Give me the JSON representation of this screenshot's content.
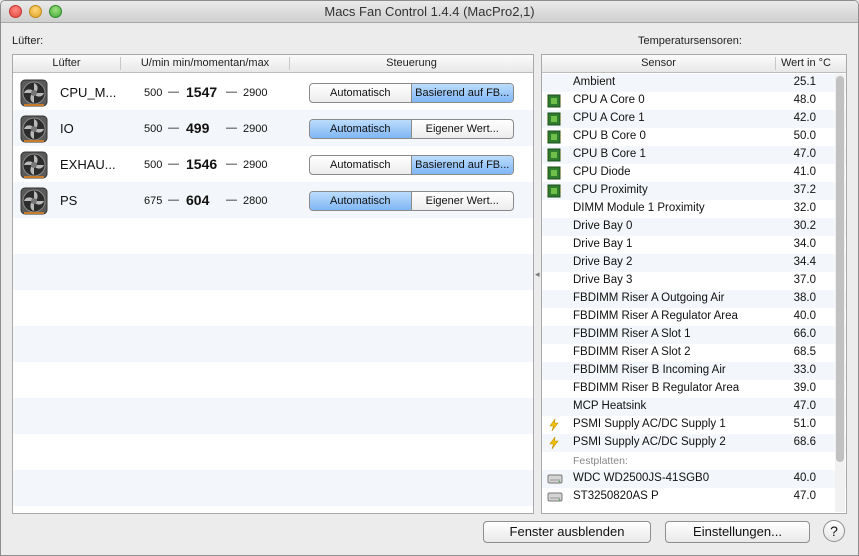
{
  "window": {
    "title": "Macs Fan Control 1.4.4 (MacPro2,1)"
  },
  "fans_section": {
    "label": "Lüfter:",
    "headers": {
      "name": "Lüfter",
      "rpm": "U/min min/momentan/max",
      "control": "Steuerung"
    },
    "dash": "—",
    "fans": [
      {
        "name": "CPU_M...",
        "min": "500",
        "current": "1547",
        "max": "2900",
        "btn_auto": "Automatisch",
        "btn_custom": "Basierend auf FB...",
        "selected": "custom"
      },
      {
        "name": "IO",
        "min": "500",
        "current": "499",
        "max": "2900",
        "btn_auto": "Automatisch",
        "btn_custom": "Eigener Wert...",
        "selected": "auto"
      },
      {
        "name": "EXHAU...",
        "min": "500",
        "current": "1546",
        "max": "2900",
        "btn_auto": "Automatisch",
        "btn_custom": "Basierend auf FB...",
        "selected": "custom"
      },
      {
        "name": "PS",
        "min": "675",
        "current": "604",
        "max": "2800",
        "btn_auto": "Automatisch",
        "btn_custom": "Eigener Wert...",
        "selected": "auto"
      }
    ]
  },
  "sensors_section": {
    "label": "Temperatursensoren:",
    "headers": {
      "sensor": "Sensor",
      "value": "Wert in °C"
    },
    "rows": [
      {
        "name": "Ambient",
        "value": "25.1",
        "icon": "none"
      },
      {
        "name": "CPU A Core 0",
        "value": "48.0",
        "icon": "chip-icon"
      },
      {
        "name": "CPU A Core 1",
        "value": "42.0",
        "icon": "chip-icon"
      },
      {
        "name": "CPU B Core 0",
        "value": "50.0",
        "icon": "chip-icon"
      },
      {
        "name": "CPU B Core 1",
        "value": "47.0",
        "icon": "chip-icon"
      },
      {
        "name": "CPU Diode",
        "value": "41.0",
        "icon": "chip-icon"
      },
      {
        "name": "CPU Proximity",
        "value": "37.2",
        "icon": "chip-icon"
      },
      {
        "name": "DIMM Module 1 Proximity",
        "value": "32.0",
        "icon": "none"
      },
      {
        "name": "Drive Bay 0",
        "value": "30.2",
        "icon": "none"
      },
      {
        "name": "Drive Bay 1",
        "value": "34.0",
        "icon": "none"
      },
      {
        "name": "Drive Bay 2",
        "value": "34.4",
        "icon": "none"
      },
      {
        "name": "Drive Bay 3",
        "value": "37.0",
        "icon": "none"
      },
      {
        "name": "FBDIMM Riser A Outgoing Air",
        "value": "38.0",
        "icon": "none"
      },
      {
        "name": "FBDIMM Riser A Regulator Area",
        "value": "40.0",
        "icon": "none"
      },
      {
        "name": "FBDIMM Riser A Slot 1",
        "value": "66.0",
        "icon": "none"
      },
      {
        "name": "FBDIMM Riser A Slot 2",
        "value": "68.5",
        "icon": "none"
      },
      {
        "name": "FBDIMM Riser B Incoming Air",
        "value": "33.0",
        "icon": "none"
      },
      {
        "name": "FBDIMM Riser B Regulator Area",
        "value": "39.0",
        "icon": "none"
      },
      {
        "name": "MCP Heatsink",
        "value": "47.0",
        "icon": "none"
      },
      {
        "name": "PSMI Supply AC/DC Supply 1",
        "value": "51.0",
        "icon": "lightning-icon"
      },
      {
        "name": "PSMI Supply AC/DC Supply 2",
        "value": "68.6",
        "icon": "lightning-icon"
      },
      {
        "group": "Festplatten:"
      },
      {
        "name": "WDC WD2500JS-41SGB0",
        "value": "40.0",
        "icon": "hard-drive-icon"
      },
      {
        "name": "ST3250820AS P",
        "value": "47.0",
        "icon": "hard-drive-icon"
      }
    ]
  },
  "footer": {
    "hide_window": "Fenster ausblenden",
    "settings": "Einstellungen...",
    "help": "?"
  }
}
